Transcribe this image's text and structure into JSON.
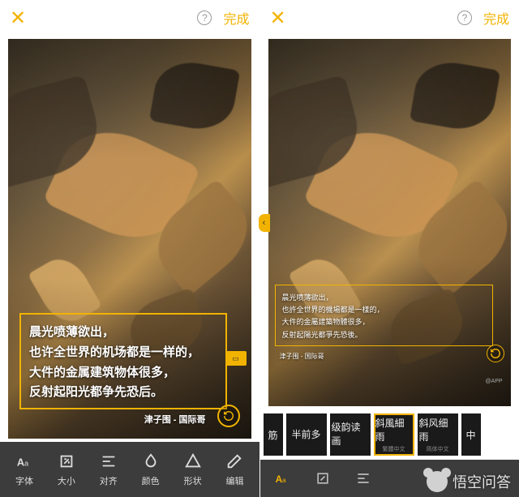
{
  "accent": "#f2b300",
  "topbar": {
    "close_glyph": "✕",
    "help_glyph": "?",
    "done_label": "完成"
  },
  "poem_large": {
    "lines": [
      "晨光喷薄欲出，",
      "也许全世界的机场都是一样的，",
      "大件的金属建筑物体很多，",
      "反射起阳光都争先恐后。"
    ],
    "caption": "津子围 - 国际哥"
  },
  "poem_small": {
    "lines": [
      "晨光喷薄欲出，",
      "也許全世界的機場都是一樣的，",
      "大件的金屬建築物體很多，",
      "反射起陽光都爭先恐後。"
    ],
    "caption": "津子围 - 国际哥",
    "wm": "@APP"
  },
  "toolbar": [
    {
      "id": "font",
      "label": "字体"
    },
    {
      "id": "size",
      "label": "大小"
    },
    {
      "id": "align",
      "label": "对齐"
    },
    {
      "id": "color",
      "label": "颜色"
    },
    {
      "id": "shape",
      "label": "形状"
    },
    {
      "id": "edit",
      "label": "编辑"
    }
  ],
  "font_strip": [
    {
      "name": "筋",
      "sub": "",
      "partial": true
    },
    {
      "name": "半前多",
      "sub": ""
    },
    {
      "name": "级韵读画",
      "sub": ""
    },
    {
      "name": "斜風細雨",
      "sub": "繁體中文",
      "selected": true
    },
    {
      "name": "斜风细雨",
      "sub": "简体中文"
    },
    {
      "name": "中",
      "sub": "",
      "partial": true
    }
  ],
  "mini_toolbar": [
    {
      "id": "font",
      "active": true
    },
    {
      "id": "size",
      "active": false
    },
    {
      "id": "align",
      "active": false
    }
  ],
  "watermark": "悟空问答"
}
